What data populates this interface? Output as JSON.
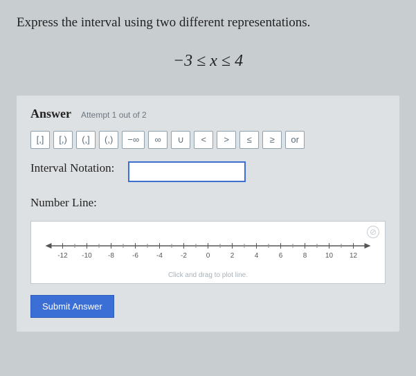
{
  "question": "Express the interval using two different representations.",
  "expression": "−3 ≤ x ≤ 4",
  "answer_label": "Answer",
  "attempt_text": "Attempt 1 out of 2",
  "buttons": [
    "[,]",
    "[,)",
    "(,]",
    "(,)",
    "−∞",
    "∞",
    "∪",
    "<",
    ">",
    "≤",
    "≥",
    "or"
  ],
  "interval_label": "Interval Notation:",
  "interval_value": "",
  "numberline_label": "Number Line:",
  "numberline_hint": "Click and drag to plot line.",
  "ticks": [
    "-12",
    "-10",
    "-8",
    "-6",
    "-4",
    "-2",
    "0",
    "2",
    "4",
    "6",
    "8",
    "10",
    "12"
  ],
  "submit_label": "Submit Answer",
  "clear_icon": "⊘"
}
